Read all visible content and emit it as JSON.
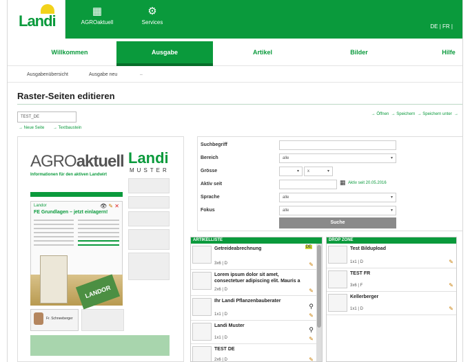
{
  "header": {
    "logo_text": "Landi",
    "nav": [
      {
        "label": "AGROaktuell",
        "icon": "grid-icon"
      },
      {
        "label": "Services",
        "icon": "gear-icon"
      }
    ],
    "lang_de": "DE",
    "lang_sep": "|",
    "lang_fr": "FR",
    "lang_sep2": "|"
  },
  "tabs": [
    {
      "label": "Willkommen",
      "active": false
    },
    {
      "label": "Ausgabe",
      "active": true
    },
    {
      "label": "Artikel",
      "active": false
    },
    {
      "label": "Bilder",
      "active": false
    },
    {
      "label": "Hilfe",
      "active": false
    }
  ],
  "subnav": {
    "overview": "Ausgabenübersicht",
    "new": "Ausgabe neu",
    "dash": "–"
  },
  "page": {
    "title": "Raster-Seiten editieren",
    "select_value": "TEST_DE",
    "link_new_page": "→ Neue Seite",
    "link_text": "→ Textbaustein",
    "link_open": "→ Öffnen",
    "link_save": "→ Speichern",
    "link_save_as": "→ Speichern unter",
    "link_more": "→"
  },
  "preview": {
    "agro": "AGRO",
    "aktuell": "aktuell",
    "claim": "Informationen für den aktiven Landwirt",
    "landi": "Landi",
    "muster": "MUSTER",
    "article_kicker": "Landor",
    "article_head": "FE Grundlagen – jetzt einlagern!",
    "bag_brand": "LANDOR",
    "person_name": "Fr. Schneeberger"
  },
  "search": {
    "labels": {
      "term": "Suchbegriff",
      "area": "Bereich",
      "size": "Grösse",
      "active_since": "Aktiv seit",
      "language": "Sprache",
      "focus": "Fokus"
    },
    "term_value": "",
    "area_value": "alle",
    "size_value_1": "",
    "size_value_2": "x",
    "active_since_value": "",
    "active_since_note": "Aktiv seit 20.05.2016",
    "language_value": "alle",
    "focus_value": "alle",
    "search_button": "Suche"
  },
  "artikelliste": {
    "title": "ARTIKELLISTE",
    "items": [
      {
        "title": "Getreideabrechnung",
        "meta": "3x6 | D",
        "badge": "DE"
      },
      {
        "title": "Lorem ipsum dolor sit amet, consectetuer adipiscing elit. Mauris a",
        "meta": "2x6 | D",
        "badge": ""
      },
      {
        "title": "Ihr Landi Pflanzenbauberater",
        "meta": "1x1 | D",
        "badge": ""
      },
      {
        "title": "Landi Muster",
        "meta": "1x1 | D",
        "badge": ""
      },
      {
        "title": "TEST DE",
        "meta": "2x6 | D",
        "badge": ""
      }
    ]
  },
  "dropzone": {
    "title": "DROP ZONE",
    "items": [
      {
        "title": "Test Bildupload",
        "meta": "1x1 | D"
      },
      {
        "title": "TEST FR",
        "meta": "3x6 | F"
      },
      {
        "title": "Kellerberger",
        "meta": "1x1 | D"
      }
    ]
  },
  "colors": {
    "brand": "#0a9a3c",
    "brand_dark": "#076e2a",
    "accent": "#f2d21b"
  }
}
